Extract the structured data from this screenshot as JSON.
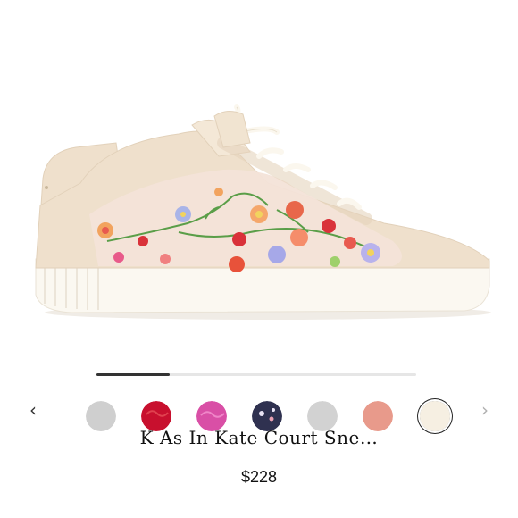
{
  "product": {
    "title": "K As In Kate Court Sne…",
    "price": "$228"
  },
  "gallery": {
    "progress": 0.23
  },
  "swatches": {
    "prev_icon": "chevron-left-icon",
    "next_icon": "chevron-right-icon",
    "prev_glyph": "‹",
    "next_glyph": "›",
    "items": [
      {
        "name": "silver",
        "color": "#c9c9c9"
      },
      {
        "name": "red",
        "color": "#c8102e"
      },
      {
        "name": "pink",
        "color": "#d94fa6"
      },
      {
        "name": "navy-print",
        "color": "#2f3150"
      },
      {
        "name": "light-gray",
        "color": "#cfcfcf"
      },
      {
        "name": "blush",
        "color": "#e8998a"
      },
      {
        "name": "cream",
        "color": "#f5eee1"
      }
    ],
    "selected_index": 6
  },
  "colors": {
    "shoe_leather": "#efe0cc",
    "shoe_sole": "#faf6ee",
    "mesh": "#f3e3d8"
  }
}
